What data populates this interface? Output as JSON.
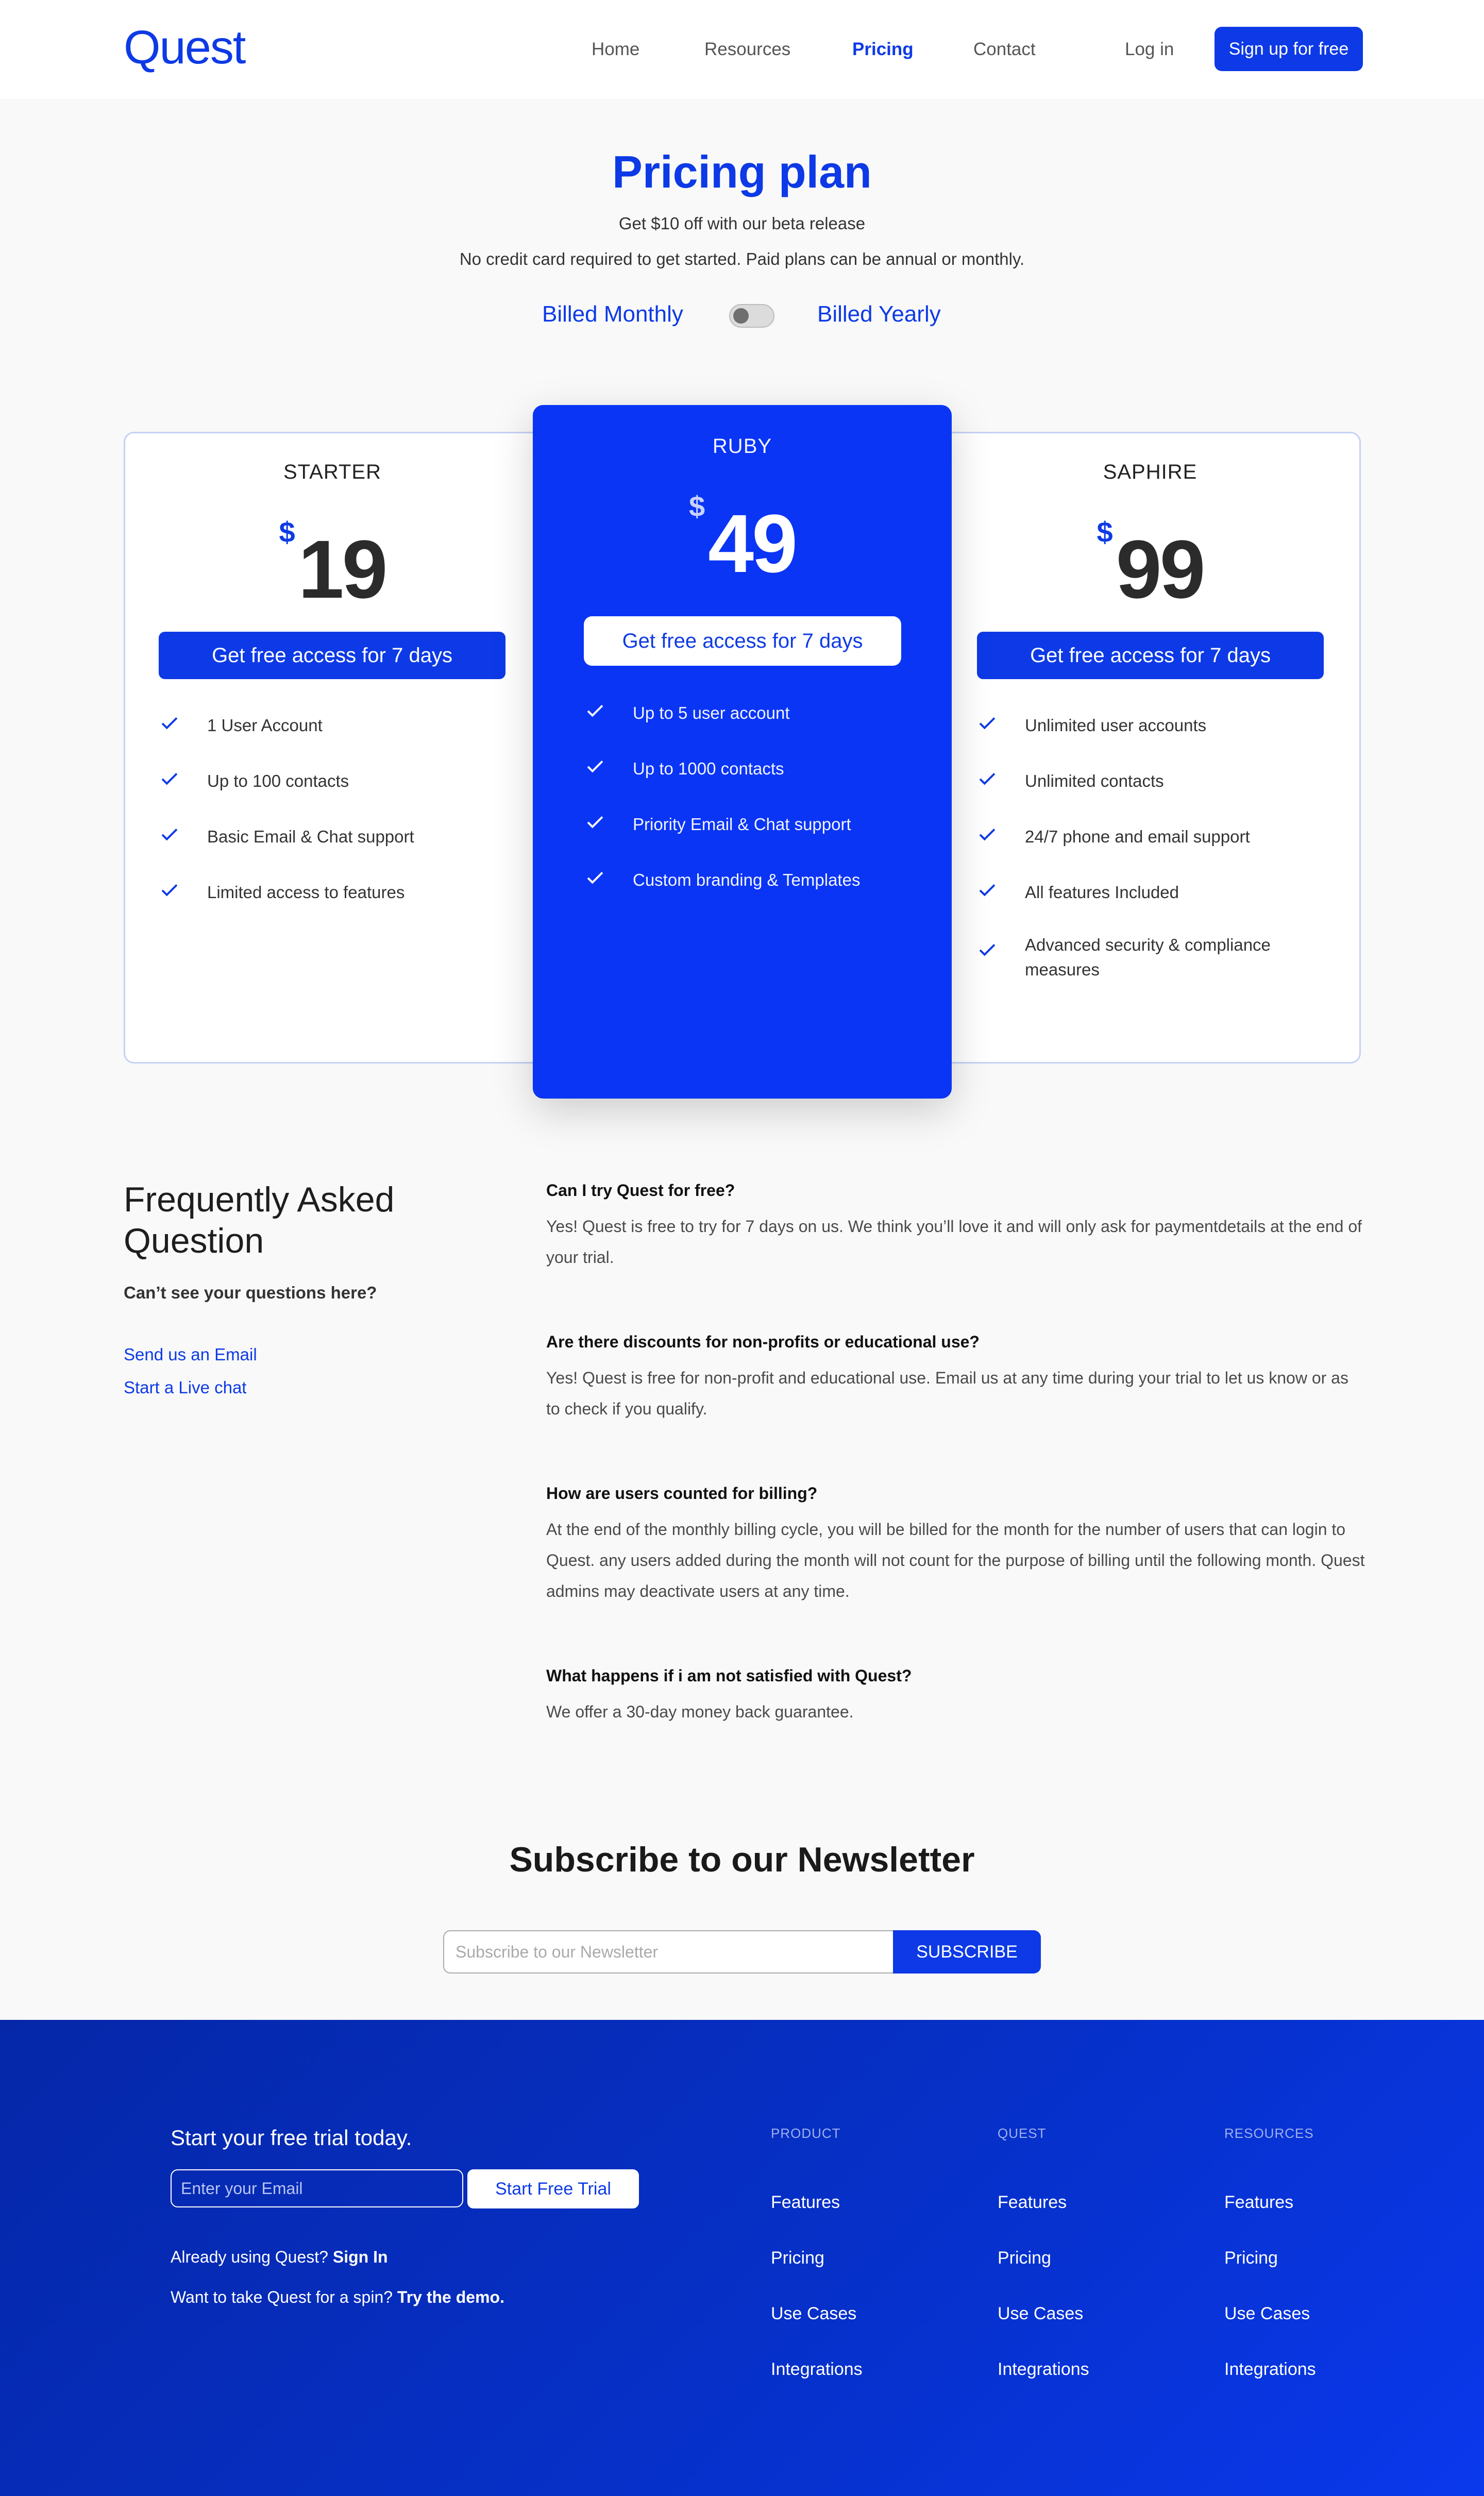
{
  "header": {
    "logo": "Quest",
    "nav": [
      "Home",
      "Resources",
      "Pricing",
      "Contact"
    ],
    "login": "Log in",
    "signup": "Sign up for free"
  },
  "hero": {
    "title": "Pricing plan",
    "subtitle1": "Get $10 off with our beta release",
    "subtitle2": "No credit card required to get started. Paid plans can be annual or monthly.",
    "billed_monthly": "Billed Monthly",
    "billed_yearly": "Billed Yearly",
    "toggle_yearly": false
  },
  "plans": [
    {
      "name": "STARTER",
      "currency": "$",
      "price": "19",
      "cta": "Get free access for 7 days",
      "features": [
        "1 User Account",
        "Up to 100 contacts",
        "Basic Email & Chat support",
        "Limited access to features"
      ]
    },
    {
      "name": "RUBY",
      "currency": "$",
      "price": "49",
      "cta": "Get free access for 7 days",
      "features": [
        "Up to 5 user account",
        "Up to 1000 contacts",
        "Priority Email & Chat support",
        "Custom branding & Templates"
      ]
    },
    {
      "name": "SAPHIRE",
      "currency": "$",
      "price": "99",
      "cta": "Get free access for 7 days",
      "features": [
        "Unlimited user accounts",
        "Unlimited contacts",
        "24/7 phone and email support",
        "All features Included",
        "Advanced security & compliance measures"
      ]
    }
  ],
  "faq": {
    "title": "Frequently Asked Question",
    "cant_see": "Can’t see your questions here?",
    "send_email": "Send us an Email",
    "live_chat": "Start a Live chat",
    "items": [
      {
        "q": "Can I try Quest for free?",
        "a": "Yes! Quest is free to try for 7 days on us. We think you’ll love it and will  only ask for paymentdetails at the end of your trial."
      },
      {
        "q": "Are there discounts for non-profits or educational use?",
        "a": "Yes! Quest is free for non-profit and educational use. Email us at any time during your trial to let us know or as to check if you qualify."
      },
      {
        "q": "How are users  counted for billing?",
        "a": "At the end of the monthly billing cycle, you will be billed for the month for the number of users that can login to Quest. any users added during the month will not count for the purpose of billing until the following month. Quest admins may deactivate users at any time."
      },
      {
        "q": "What happens if i am not satisfied with Quest?",
        "a": "We offer a 30-day money back guarantee."
      }
    ]
  },
  "newsletter": {
    "title": "Subscribe to our Newsletter",
    "placeholder": "Subscribe to our Newsletter",
    "button": "SUBSCRIBE"
  },
  "footer": {
    "title": "Start your free trial today.",
    "email_placeholder": "Enter your Email",
    "trial_button": "Start Free Trial",
    "already_prefix": "Already using Quest?",
    "sign_in": "Sign In",
    "demo_prefix": "Want to take Quest for a spin?",
    "try_demo": "Try the demo.",
    "columns": [
      {
        "heading": "PRODUCT",
        "links": [
          "Features",
          "Pricing",
          "Use Cases",
          "Integrations"
        ]
      },
      {
        "heading": "QUEST",
        "links": [
          "Features",
          "Pricing",
          "Use Cases",
          "Integrations"
        ]
      },
      {
        "heading": "RESOURCES",
        "links": [
          "Features",
          "Pricing",
          "Use Cases",
          "Integrations"
        ]
      }
    ]
  },
  "colors": {
    "brand": "#0d3ae6",
    "ruby_card": "#0a35f5",
    "footer": "#0630c8"
  }
}
